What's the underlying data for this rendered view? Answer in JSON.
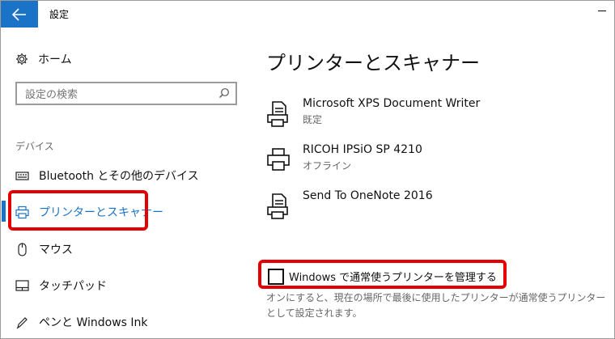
{
  "window": {
    "title": "設定",
    "back_icon": "arrow-left-icon",
    "accent": "#1a73c6"
  },
  "sidebar": {
    "home_label": "ホーム",
    "search_placeholder": "設定の検索",
    "section_label": "デバイス",
    "items": [
      {
        "label": "Bluetooth とその他のデバイス",
        "icon": "bluetooth-devices-icon"
      },
      {
        "label": "プリンターとスキャナー",
        "icon": "printer-icon",
        "selected": true
      },
      {
        "label": "マウス",
        "icon": "mouse-icon"
      },
      {
        "label": "タッチパッド",
        "icon": "touchpad-icon"
      },
      {
        "label": "ペンと Windows Ink",
        "icon": "pen-icon"
      }
    ]
  },
  "main": {
    "heading": "プリンターとスキャナー",
    "printers": [
      {
        "name": "Microsoft XPS Document Writer",
        "status": "既定",
        "icon": "document-printer-icon"
      },
      {
        "name": "RICOH IPSiO SP 4210",
        "status": "オフライン",
        "icon": "printer-icon"
      },
      {
        "name": "Send To OneNote 2016",
        "status": "",
        "icon": "document-printer-icon"
      }
    ],
    "manage_default": {
      "label": "Windows で通常使うプリンターを管理する",
      "checked": false,
      "description": "オンにすると、現在の場所で最後に使用したプリンターが通常使うプリンターとして設定されます。"
    }
  },
  "highlight_color": "#e40000"
}
